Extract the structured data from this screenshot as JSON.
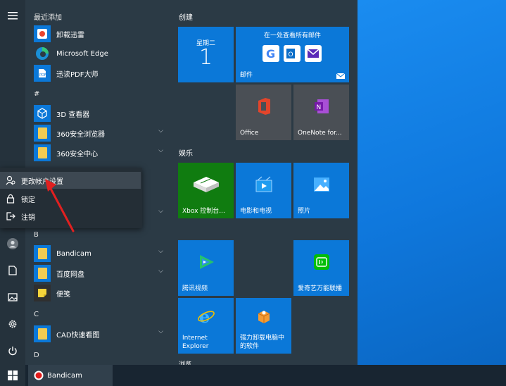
{
  "start_menu": {
    "recent_header": "最近添加",
    "recent_apps": [
      {
        "label": "卸载迅雷",
        "icon": "thunder-uninstall-icon"
      },
      {
        "label": "Microsoft Edge",
        "icon": "edge-icon"
      },
      {
        "label": "迅读PDF大师",
        "icon": "pdf-icon"
      }
    ],
    "section_hash": "#",
    "hash_apps": [
      {
        "label": "3D 查看器",
        "icon": "3d-viewer-icon"
      },
      {
        "label": "360安全浏览器",
        "icon": "folder-icon"
      },
      {
        "label": "360安全中心",
        "icon": "folder-icon"
      }
    ],
    "section_b": "B",
    "b_apps": [
      {
        "label": "Bandicam",
        "icon": "folder-icon"
      },
      {
        "label": "百度网盘",
        "icon": "folder-icon"
      },
      {
        "label": "便笺",
        "icon": "sticky-notes-icon"
      }
    ],
    "section_c": "C",
    "c_apps": [
      {
        "label": "CAD快速看图",
        "icon": "folder-icon"
      }
    ],
    "section_d": "D"
  },
  "account_menu": {
    "items": [
      {
        "label": "更改帐户设置",
        "icon": "user-settings-icon",
        "highlighted": true
      },
      {
        "label": "锁定",
        "icon": "lock-icon"
      },
      {
        "label": "注销",
        "icon": "sign-out-icon"
      }
    ]
  },
  "tiles": {
    "group_create": "创建",
    "calendar": {
      "day_name": "星期二",
      "day": "1"
    },
    "mail": {
      "header": "在一处查看所有邮件",
      "label": "邮件"
    },
    "office": {
      "label": "Office"
    },
    "onenote": {
      "label": "OneNote for..."
    },
    "group_entertainment": "娱乐",
    "xbox": {
      "label": "Xbox 控制台..."
    },
    "movies": {
      "label": "电影和电视"
    },
    "photos": {
      "label": "照片"
    },
    "tencent": {
      "label": "腾讯视频"
    },
    "iqiyi": {
      "label": "爱奇艺万能联播"
    },
    "ie": {
      "label_line1": "Internet",
      "label_line2": "Explorer"
    },
    "uninstall": {
      "label_line1": "强力卸载电脑中",
      "label_line2": "的软件"
    },
    "group_partial": "浏览"
  },
  "taskbar": {
    "running_app": "Bandicam"
  },
  "colors": {
    "tile_blue": "#0b78d8",
    "tile_gray": "#4a4f55",
    "xbox_green": "#107c10",
    "menu_bg": "#2b3a45",
    "arrow_red": "#e02020"
  }
}
